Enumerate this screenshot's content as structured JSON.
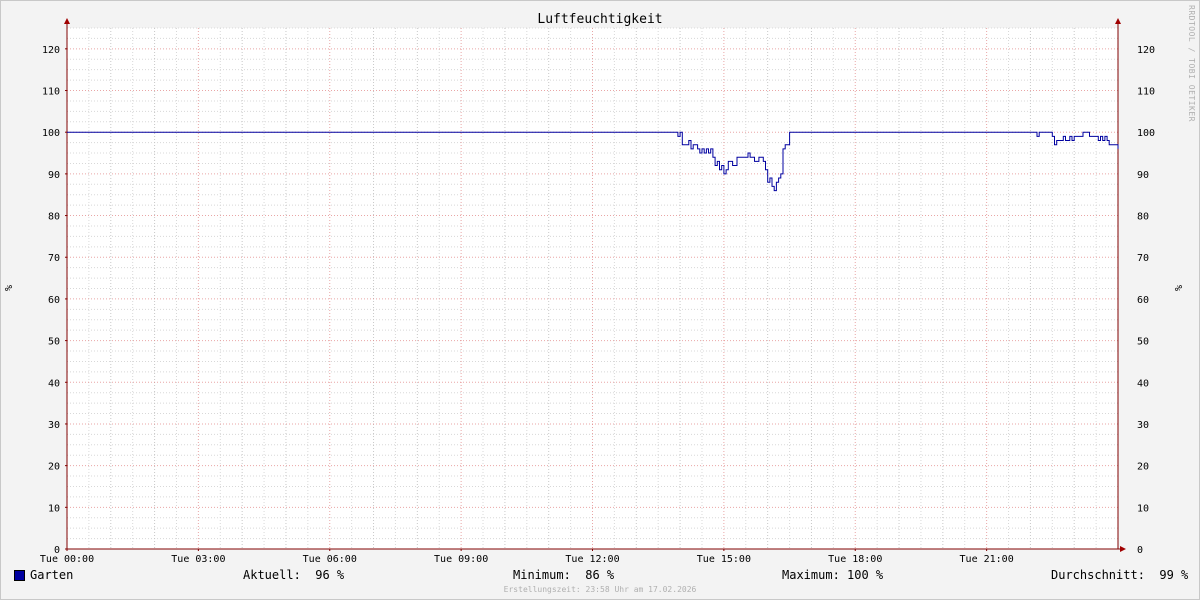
{
  "chart_data": {
    "type": "line",
    "title": "Luftfeuchtigkeit",
    "ylabel": "%",
    "ylabel_right": "%",
    "ylim": [
      0,
      125
    ],
    "y_ticks": [
      0,
      10,
      20,
      30,
      40,
      50,
      60,
      70,
      80,
      90,
      100,
      110,
      120
    ],
    "xlim_hours": [
      0,
      24
    ],
    "x_ticks": [
      {
        "hour": 0,
        "label": "Tue 00:00"
      },
      {
        "hour": 3,
        "label": "Tue 03:00"
      },
      {
        "hour": 6,
        "label": "Tue 06:00"
      },
      {
        "hour": 9,
        "label": "Tue 09:00"
      },
      {
        "hour": 12,
        "label": "Tue 12:00"
      },
      {
        "hour": 15,
        "label": "Tue 15:00"
      },
      {
        "hour": 18,
        "label": "Tue 18:00"
      },
      {
        "hour": 21,
        "label": "Tue 21:00"
      }
    ],
    "grid": true,
    "series": [
      {
        "name": "Garten",
        "color": "#0000a0",
        "points": [
          [
            0,
            100
          ],
          [
            13.9,
            100
          ],
          [
            13.95,
            99
          ],
          [
            14.0,
            100
          ],
          [
            14.05,
            97
          ],
          [
            14.15,
            97
          ],
          [
            14.2,
            98
          ],
          [
            14.25,
            96
          ],
          [
            14.3,
            97
          ],
          [
            14.4,
            96
          ],
          [
            14.45,
            95
          ],
          [
            14.5,
            96
          ],
          [
            14.55,
            95
          ],
          [
            14.6,
            96
          ],
          [
            14.65,
            95
          ],
          [
            14.7,
            96
          ],
          [
            14.75,
            94
          ],
          [
            14.8,
            92
          ],
          [
            14.85,
            93
          ],
          [
            14.9,
            91
          ],
          [
            14.95,
            92
          ],
          [
            15.0,
            90
          ],
          [
            15.05,
            91
          ],
          [
            15.1,
            93
          ],
          [
            15.2,
            92
          ],
          [
            15.3,
            94
          ],
          [
            15.4,
            94
          ],
          [
            15.5,
            94
          ],
          [
            15.55,
            95
          ],
          [
            15.6,
            94
          ],
          [
            15.7,
            93
          ],
          [
            15.8,
            94
          ],
          [
            15.9,
            93
          ],
          [
            15.95,
            91
          ],
          [
            16.0,
            88
          ],
          [
            16.05,
            89
          ],
          [
            16.1,
            87
          ],
          [
            16.15,
            86
          ],
          [
            16.2,
            88
          ],
          [
            16.25,
            89
          ],
          [
            16.3,
            90
          ],
          [
            16.35,
            96
          ],
          [
            16.4,
            97
          ],
          [
            16.45,
            97
          ],
          [
            16.5,
            100
          ],
          [
            22.1,
            100
          ],
          [
            22.15,
            99
          ],
          [
            22.2,
            100
          ],
          [
            22.45,
            100
          ],
          [
            22.5,
            99
          ],
          [
            22.55,
            97
          ],
          [
            22.6,
            98
          ],
          [
            22.7,
            98
          ],
          [
            22.75,
            99
          ],
          [
            22.8,
            98
          ],
          [
            22.9,
            99
          ],
          [
            22.95,
            98
          ],
          [
            23.0,
            99
          ],
          [
            23.1,
            99
          ],
          [
            23.2,
            100
          ],
          [
            23.3,
            100
          ],
          [
            23.35,
            99
          ],
          [
            23.5,
            99
          ],
          [
            23.55,
            98
          ],
          [
            23.6,
            99
          ],
          [
            23.65,
            98
          ],
          [
            23.7,
            99
          ],
          [
            23.75,
            98
          ],
          [
            23.8,
            97
          ],
          [
            23.9,
            97
          ],
          [
            24.0,
            96
          ]
        ]
      }
    ]
  },
  "legend": {
    "series_name": "Garten",
    "aktuell": "Aktuell:  96 %",
    "minimum": "Minimum:  86 %",
    "maximum": "Maximum: 100 %",
    "durchschnitt": "Durchschnitt:  99 %"
  },
  "footer": "Erstellungszeit: 23:58 Uhr am 17.02.2026",
  "watermark": "RRDTOOL / TOBI OETIKER"
}
